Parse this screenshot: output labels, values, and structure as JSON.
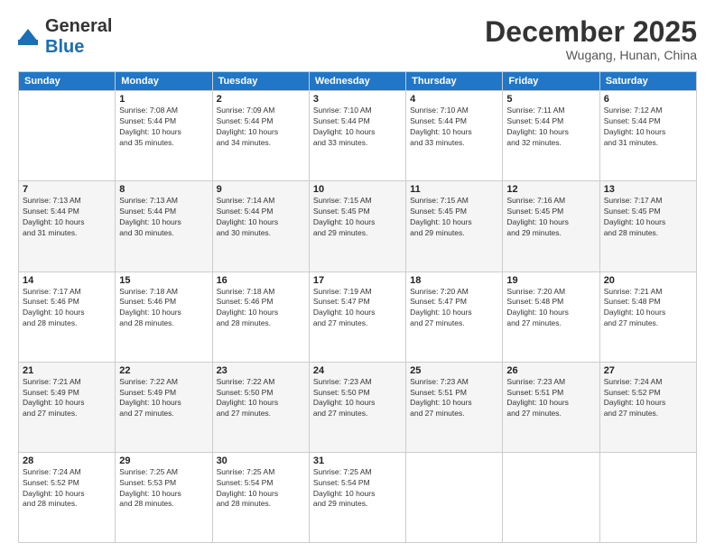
{
  "header": {
    "logo_general": "General",
    "logo_blue": "Blue",
    "month": "December 2025",
    "location": "Wugang, Hunan, China"
  },
  "days_of_week": [
    "Sunday",
    "Monday",
    "Tuesday",
    "Wednesday",
    "Thursday",
    "Friday",
    "Saturday"
  ],
  "weeks": [
    [
      {
        "day": "",
        "info": ""
      },
      {
        "day": "1",
        "info": "Sunrise: 7:08 AM\nSunset: 5:44 PM\nDaylight: 10 hours\nand 35 minutes."
      },
      {
        "day": "2",
        "info": "Sunrise: 7:09 AM\nSunset: 5:44 PM\nDaylight: 10 hours\nand 34 minutes."
      },
      {
        "day": "3",
        "info": "Sunrise: 7:10 AM\nSunset: 5:44 PM\nDaylight: 10 hours\nand 33 minutes."
      },
      {
        "day": "4",
        "info": "Sunrise: 7:10 AM\nSunset: 5:44 PM\nDaylight: 10 hours\nand 33 minutes."
      },
      {
        "day": "5",
        "info": "Sunrise: 7:11 AM\nSunset: 5:44 PM\nDaylight: 10 hours\nand 32 minutes."
      },
      {
        "day": "6",
        "info": "Sunrise: 7:12 AM\nSunset: 5:44 PM\nDaylight: 10 hours\nand 31 minutes."
      }
    ],
    [
      {
        "day": "7",
        "info": "Sunrise: 7:13 AM\nSunset: 5:44 PM\nDaylight: 10 hours\nand 31 minutes."
      },
      {
        "day": "8",
        "info": "Sunrise: 7:13 AM\nSunset: 5:44 PM\nDaylight: 10 hours\nand 30 minutes."
      },
      {
        "day": "9",
        "info": "Sunrise: 7:14 AM\nSunset: 5:44 PM\nDaylight: 10 hours\nand 30 minutes."
      },
      {
        "day": "10",
        "info": "Sunrise: 7:15 AM\nSunset: 5:45 PM\nDaylight: 10 hours\nand 29 minutes."
      },
      {
        "day": "11",
        "info": "Sunrise: 7:15 AM\nSunset: 5:45 PM\nDaylight: 10 hours\nand 29 minutes."
      },
      {
        "day": "12",
        "info": "Sunrise: 7:16 AM\nSunset: 5:45 PM\nDaylight: 10 hours\nand 29 minutes."
      },
      {
        "day": "13",
        "info": "Sunrise: 7:17 AM\nSunset: 5:45 PM\nDaylight: 10 hours\nand 28 minutes."
      }
    ],
    [
      {
        "day": "14",
        "info": "Sunrise: 7:17 AM\nSunset: 5:46 PM\nDaylight: 10 hours\nand 28 minutes."
      },
      {
        "day": "15",
        "info": "Sunrise: 7:18 AM\nSunset: 5:46 PM\nDaylight: 10 hours\nand 28 minutes."
      },
      {
        "day": "16",
        "info": "Sunrise: 7:18 AM\nSunset: 5:46 PM\nDaylight: 10 hours\nand 28 minutes."
      },
      {
        "day": "17",
        "info": "Sunrise: 7:19 AM\nSunset: 5:47 PM\nDaylight: 10 hours\nand 27 minutes."
      },
      {
        "day": "18",
        "info": "Sunrise: 7:20 AM\nSunset: 5:47 PM\nDaylight: 10 hours\nand 27 minutes."
      },
      {
        "day": "19",
        "info": "Sunrise: 7:20 AM\nSunset: 5:48 PM\nDaylight: 10 hours\nand 27 minutes."
      },
      {
        "day": "20",
        "info": "Sunrise: 7:21 AM\nSunset: 5:48 PM\nDaylight: 10 hours\nand 27 minutes."
      }
    ],
    [
      {
        "day": "21",
        "info": "Sunrise: 7:21 AM\nSunset: 5:49 PM\nDaylight: 10 hours\nand 27 minutes."
      },
      {
        "day": "22",
        "info": "Sunrise: 7:22 AM\nSunset: 5:49 PM\nDaylight: 10 hours\nand 27 minutes."
      },
      {
        "day": "23",
        "info": "Sunrise: 7:22 AM\nSunset: 5:50 PM\nDaylight: 10 hours\nand 27 minutes."
      },
      {
        "day": "24",
        "info": "Sunrise: 7:23 AM\nSunset: 5:50 PM\nDaylight: 10 hours\nand 27 minutes."
      },
      {
        "day": "25",
        "info": "Sunrise: 7:23 AM\nSunset: 5:51 PM\nDaylight: 10 hours\nand 27 minutes."
      },
      {
        "day": "26",
        "info": "Sunrise: 7:23 AM\nSunset: 5:51 PM\nDaylight: 10 hours\nand 27 minutes."
      },
      {
        "day": "27",
        "info": "Sunrise: 7:24 AM\nSunset: 5:52 PM\nDaylight: 10 hours\nand 27 minutes."
      }
    ],
    [
      {
        "day": "28",
        "info": "Sunrise: 7:24 AM\nSunset: 5:52 PM\nDaylight: 10 hours\nand 28 minutes."
      },
      {
        "day": "29",
        "info": "Sunrise: 7:25 AM\nSunset: 5:53 PM\nDaylight: 10 hours\nand 28 minutes."
      },
      {
        "day": "30",
        "info": "Sunrise: 7:25 AM\nSunset: 5:54 PM\nDaylight: 10 hours\nand 28 minutes."
      },
      {
        "day": "31",
        "info": "Sunrise: 7:25 AM\nSunset: 5:54 PM\nDaylight: 10 hours\nand 29 minutes."
      },
      {
        "day": "",
        "info": ""
      },
      {
        "day": "",
        "info": ""
      },
      {
        "day": "",
        "info": ""
      }
    ]
  ]
}
